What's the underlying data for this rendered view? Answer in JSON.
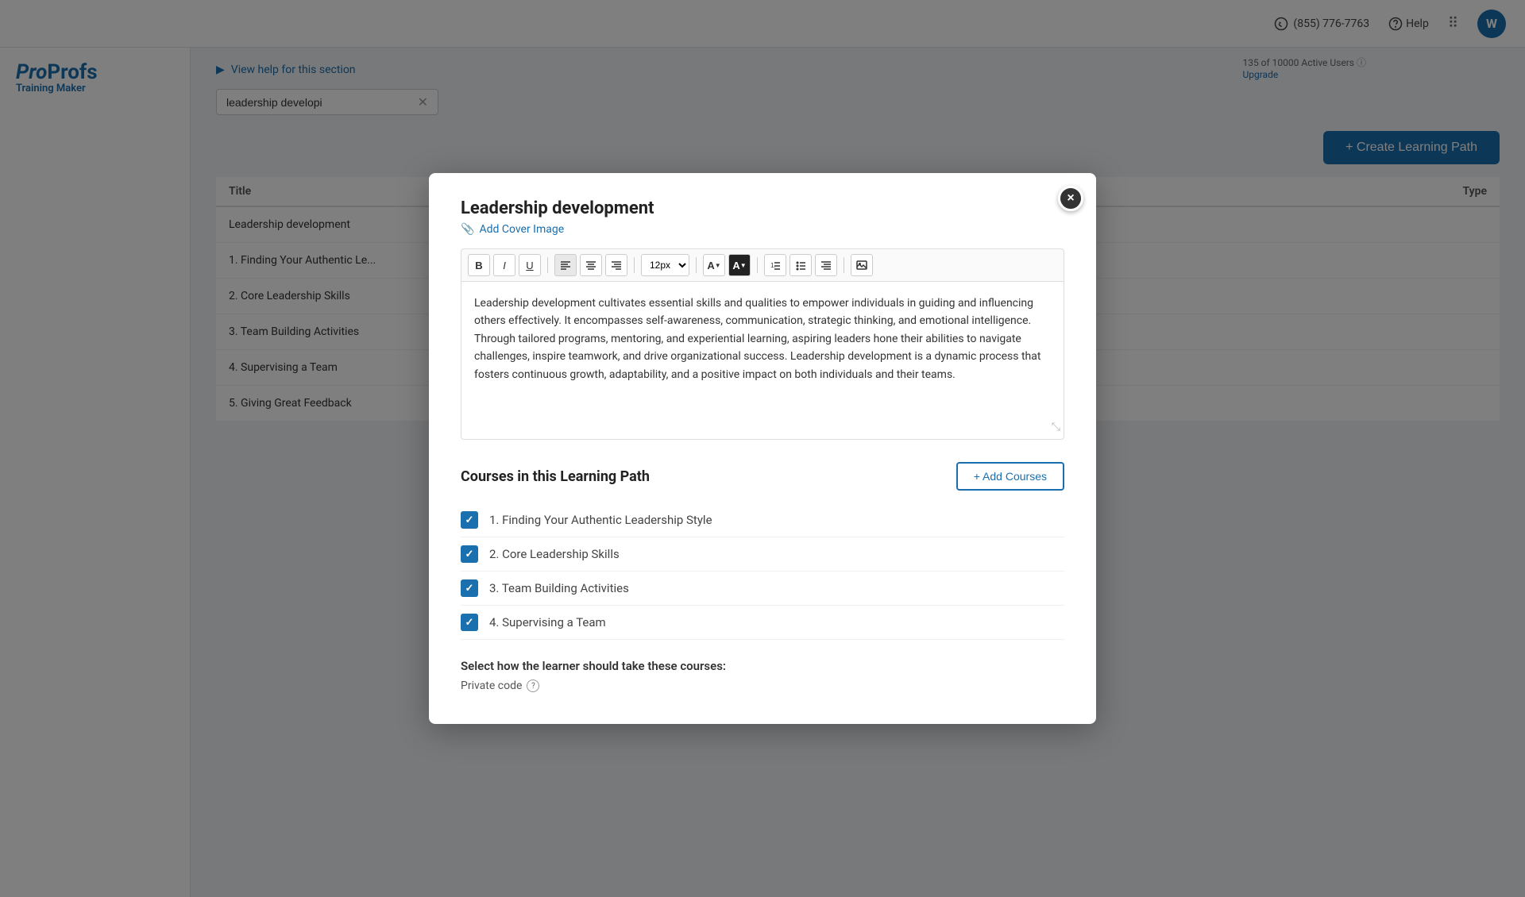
{
  "topnav": {
    "phone": "(855) 776-7763",
    "help": "Help",
    "avatar_letter": "W"
  },
  "sidebar": {
    "brand_pro": "Pro",
    "brand_profs": "Profs",
    "brand_sub": "Training Maker"
  },
  "main": {
    "help_label": "View help for this section",
    "search_placeholder": "leadership developi",
    "create_btn": "+ Create Learning Path",
    "table": {
      "col_title": "Title",
      "col_type": "Type",
      "rows": [
        {
          "title": "Leadership development"
        },
        {
          "title": "1. Finding Your Authentic Le..."
        },
        {
          "title": "2. Core Leadership Skills"
        },
        {
          "title": "3. Team Building Activities"
        },
        {
          "title": "4. Supervising a Team"
        },
        {
          "title": "5. Giving Great Feedback"
        }
      ]
    },
    "active_users": "135 of 10000 Active Users",
    "upgrade": "Upgrade"
  },
  "modal": {
    "title": "Leadership development",
    "add_cover": "Add Cover Image",
    "close_label": "×",
    "description": "Leadership development cultivates essential skills and qualities to empower individuals in guiding and influencing others effectively. It encompasses self-awareness, communication, strategic thinking, and emotional intelligence. Through tailored programs, mentoring, and experiential learning, aspiring leaders hone their abilities to navigate challenges, inspire teamwork, and drive organizational success. Leadership development is a dynamic process that fosters continuous growth, adaptability, and a positive impact on both individuals and their teams.",
    "font_size": "12px",
    "toolbar_buttons": [
      "B",
      "I",
      "U",
      "≡",
      "≡",
      "≡"
    ],
    "courses_section_title": "Courses in this Learning Path",
    "add_courses_btn": "+ Add Courses",
    "courses": [
      {
        "label": "1. Finding Your Authentic Leadership Style",
        "checked": true
      },
      {
        "label": "2. Core Leadership Skills",
        "checked": true
      },
      {
        "label": "3. Team Building Activities",
        "checked": true
      },
      {
        "label": "4. Supervising a Team",
        "checked": true
      }
    ],
    "learner_select_title": "Select how the learner should take these courses:",
    "private_code_label": "Private code"
  }
}
